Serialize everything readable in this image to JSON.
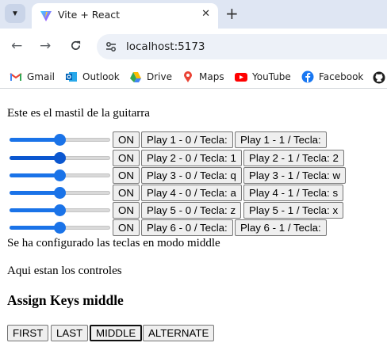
{
  "browser": {
    "tab_title": "Vite + React",
    "close_glyph": "✕",
    "new_tab_glyph": "+",
    "url": "localhost:5173",
    "bookmarks": [
      {
        "label": "Gmail",
        "icon": "gmail-icon"
      },
      {
        "label": "Outlook",
        "icon": "outlook-icon"
      },
      {
        "label": "Drive",
        "icon": "drive-icon"
      },
      {
        "label": "Maps",
        "icon": "maps-icon"
      },
      {
        "label": "YouTube",
        "icon": "youtube-icon"
      },
      {
        "label": "Facebook",
        "icon": "facebook-icon"
      }
    ]
  },
  "page": {
    "intro": "Este es el mastil de la guitarra",
    "strings": [
      {
        "toggle": "ON",
        "slider_value": 0.5,
        "play0": "Play 1 - 0 / Tecla:",
        "play1": "Play 1 - 1 / Tecla:"
      },
      {
        "toggle": "ON",
        "slider_value": 0.5,
        "play0": "Play 2 - 0 / Tecla: 1",
        "play1": "Play 2 - 1 / Tecla: 2"
      },
      {
        "toggle": "ON",
        "slider_value": 0.5,
        "play0": "Play 3 - 0 / Tecla: q",
        "play1": "Play 3 - 1 / Tecla: w"
      },
      {
        "toggle": "ON",
        "slider_value": 0.5,
        "play0": "Play 4 - 0 / Tecla: a",
        "play1": "Play 4 - 1 / Tecla: s"
      },
      {
        "toggle": "ON",
        "slider_value": 0.5,
        "play0": "Play 5 - 0 / Tecla: z",
        "play1": "Play 5 - 1 / Tecla: x"
      },
      {
        "toggle": "ON",
        "slider_value": 0.5,
        "play0": "Play 6 - 0 / Tecla:",
        "play1": "Play 6 - 1 / Tecla:"
      }
    ],
    "config_msg": "Se ha configurado las teclas en modo middle",
    "controls_msg": "Aqui estan los controles",
    "assign_title": "Assign Keys middle",
    "modes": [
      "FIRST",
      "LAST",
      "MIDDLE",
      "ALTERNATE"
    ],
    "active_mode": "MIDDLE"
  },
  "colors": {
    "accent": "#1a73e8"
  }
}
